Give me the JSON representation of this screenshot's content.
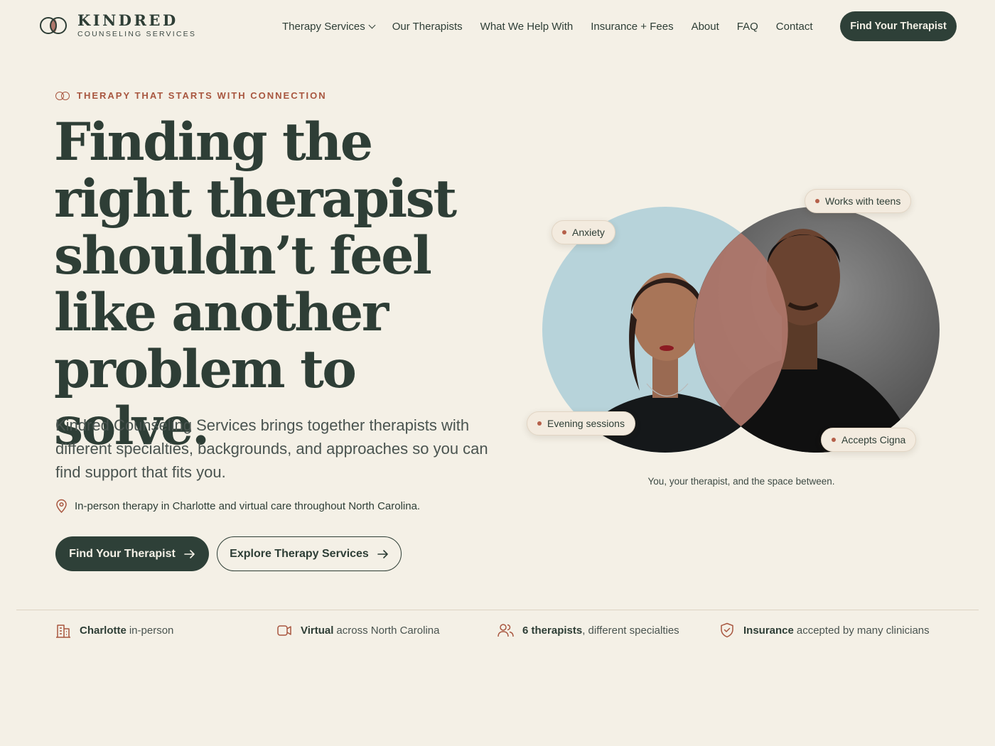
{
  "brand": {
    "name": "KINDRED",
    "tagline": "COUNSELING SERVICES"
  },
  "nav": {
    "items": [
      {
        "label": "Therapy Services",
        "has_dropdown": true
      },
      {
        "label": "Our Therapists"
      },
      {
        "label": "What We Help With"
      },
      {
        "label": "Insurance + Fees"
      },
      {
        "label": "About"
      },
      {
        "label": "FAQ"
      },
      {
        "label": "Contact"
      }
    ],
    "cta": "Find Your Therapist"
  },
  "hero": {
    "eyebrow": "THERAPY THAT STARTS WITH CONNECTION",
    "headline_lines": [
      "Finding the",
      "right therapist",
      "shouldn’t feel",
      "like another",
      "problem to solve."
    ],
    "lede": "Kindred Counseling Services brings together therapists with different specialties, backgrounds, and approaches so you can find support that fits you.",
    "location": "In-person therapy in Charlotte and virtual care throughout North Carolina.",
    "primary_button": "Find Your Therapist",
    "secondary_button": "Explore Therapy Services"
  },
  "visual": {
    "chips": [
      "Anxiety",
      "Works with teens",
      "Evening sessions",
      "Accepts Cigna"
    ],
    "caption": "You, your therapist, and the space between."
  },
  "stats": [
    {
      "bold": "Charlotte",
      "rest": "in-person",
      "icon": "building-icon"
    },
    {
      "bold": "Virtual",
      "rest": "across North Carolina",
      "icon": "video-icon"
    },
    {
      "bold": "6 therapists",
      "rest": ", different specialties",
      "icon": "people-icon"
    },
    {
      "bold": "Insurance",
      "rest": "accepted by many clinicians",
      "icon": "shield-check-icon"
    }
  ],
  "colors": {
    "background": "#f4f0e6",
    "primary": "#2e4038",
    "accent": "#a8563f",
    "overlap": "#b0776b"
  }
}
